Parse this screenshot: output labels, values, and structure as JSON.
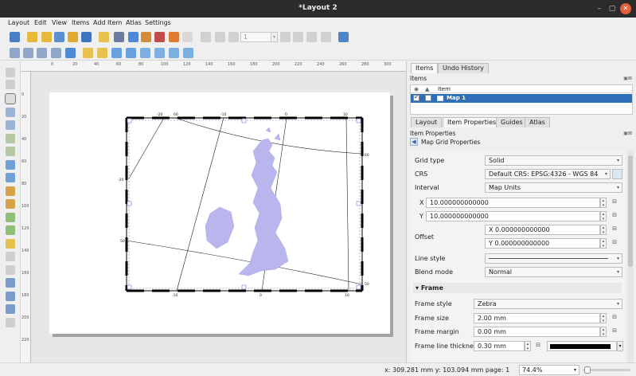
{
  "window": {
    "title": "*Layout 2",
    "minimize": "–",
    "maximize": "▢",
    "close": "✕"
  },
  "menu": [
    "Layout",
    "Edit",
    "View",
    "Items",
    "Add Item",
    "Atlas",
    "Settings"
  ],
  "toolbar": {
    "page_value": "1"
  },
  "ruler": {
    "h_ticks": [
      "0",
      "20",
      "40",
      "60",
      "80",
      "100",
      "120",
      "140",
      "160",
      "180",
      "200",
      "220",
      "240",
      "260",
      "280",
      "300"
    ],
    "v_ticks": [
      "0",
      "20",
      "40",
      "60",
      "80",
      "100",
      "120",
      "140",
      "160",
      "180",
      "200",
      "220"
    ]
  },
  "map": {
    "top_labels": [
      "-20",
      "60",
      "-10",
      "0",
      "10"
    ],
    "bottom_labels": [
      "-10",
      "0",
      "10"
    ],
    "left_labels": [
      "-20",
      "50"
    ],
    "right_labels": [
      "60",
      "50"
    ]
  },
  "dock_top": {
    "tabs": [
      "Items",
      "Undo History"
    ],
    "panel_title": "Items",
    "col_visibility_icon": "eye-icon",
    "col_lock_icon": "lock-icon",
    "col_item": "Item",
    "row_label": "Map 1"
  },
  "dock_bottom": {
    "tabs": [
      "Layout",
      "Item Properties",
      "Guides",
      "Atlas"
    ],
    "panel_title": "Item Properties",
    "back_icon": "chevron-left-icon",
    "subtitle": "Map Grid Properties"
  },
  "props": {
    "grid_type_label": "Grid type",
    "grid_type_value": "Solid",
    "crs_label": "CRS",
    "crs_value": "Default CRS: EPSG:4326 - WGS 84",
    "interval_label": "Interval",
    "interval_value": "Map Units",
    "x_label": "X",
    "x_value": "10.000000000000",
    "y_label": "Y",
    "y_value": "10.000000000000",
    "offset_label": "Offset",
    "offset_x": "X 0.000000000000",
    "offset_y": "Y 0.000000000000",
    "line_style_label": "Line style",
    "blend_mode_label": "Blend mode",
    "blend_mode_value": "Normal",
    "frame_section": "Frame",
    "frame_style_label": "Frame style",
    "frame_style_value": "Zebra",
    "frame_size_label": "Frame size",
    "frame_size_value": "2.00 mm",
    "frame_margin_label": "Frame margin",
    "frame_margin_value": "0.00 mm",
    "frame_line_label": "Frame line thickness",
    "frame_line_value": "0.30 mm"
  },
  "status": {
    "coords": "x: 309.281 mm y: 103.094 mm page: 1",
    "zoom": "74.4%"
  },
  "colors": {
    "selection": "#2f6fb8",
    "titlebar": "#2b2b2b",
    "close": "#e2603a",
    "map_fill": "#b9b6ee"
  }
}
